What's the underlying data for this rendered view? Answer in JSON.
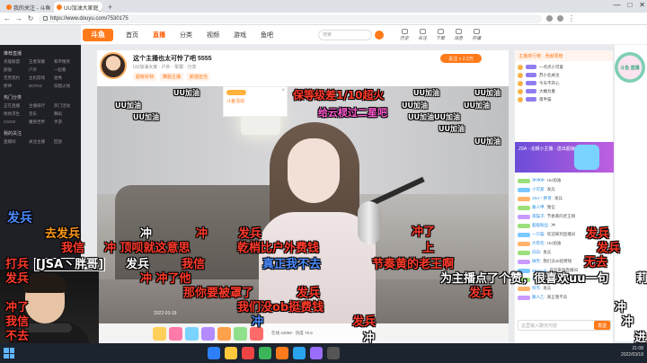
{
  "browser": {
    "tabs": [
      {
        "label": "我的关注 - 斗鱼"
      },
      {
        "label": "UU加油大家庭_户外直播"
      }
    ],
    "new_tab": "+",
    "url": "https://www.douyu.com/7530175",
    "window_controls": [
      "—",
      "□",
      "✕"
    ]
  },
  "site": {
    "logo": "斗鱼",
    "nav": [
      "首页",
      "直播",
      "分类",
      "视频",
      "游戏",
      "鱼吧"
    ],
    "nav_active_index": 1,
    "search_placeholder": "搜索",
    "header_icons": [
      "历史",
      "关注",
      "下载",
      "消息",
      "开播"
    ]
  },
  "sidebar": {
    "section_titles": [
      "推荐直播",
      "热门分类",
      "我的关注"
    ],
    "grid1": [
      "英雄联盟",
      "王者荣耀",
      "和平精英",
      "颜值",
      "户外",
      "一起看",
      "无畏契约",
      "主机游戏",
      "星秀",
      "原神",
      "DOTA2",
      "穿越火线"
    ],
    "grid2": [
      "正在直播",
      "主播排行",
      "热门活动",
      "绝地求生",
      "音乐",
      "舞蹈",
      "CSGO",
      "魔兽世界",
      "手游"
    ],
    "grid3": [
      "直播间",
      "关注主播",
      "回放"
    ]
  },
  "room": {
    "title": "这个主播也太可怜了吧 5555",
    "meta": "UU加油大家 · 户外 · 举报 · 分享",
    "tags": [
      "超级铃铛",
      "舞蹈主播",
      "颜值担当"
    ],
    "follow_label": "关注 + 2.2万"
  },
  "video": {
    "ad_text": "斗鱼活动",
    "ad_close": "×",
    "timer": "2022-03-18",
    "stats": "在线 42859 · 热度 78.8"
  },
  "right_panel": {
    "header": "主播排行榜 · 贡献周榜",
    "ranks": [
      "一点点小可爱",
      "苏小北关注",
      "今天不开心",
      "大橘为重",
      "夜半猫"
    ],
    "gift_popup": "JSA · 北朝小主播 · 送出超级火箭",
    "chat": [
      {
        "name": "冲冲冲:",
        "msg": "UU加油"
      },
      {
        "name": "小可爱:",
        "msg": "发兵"
      },
      {
        "name": "JSA丶胖哥:",
        "msg": "发兵"
      },
      {
        "name": "路人甲:",
        "msg": "我信"
      },
      {
        "name": "夜猫子:",
        "msg": "节奏黄的老王啊"
      },
      {
        "name": "超级粉丝:",
        "msg": "冲"
      },
      {
        "name": "一只猫:",
        "msg": "欢迎来到直播间"
      },
      {
        "name": "大卷毛:",
        "msg": "UU加油"
      },
      {
        "name": "白白:",
        "msg": "发兵"
      },
      {
        "name": "微笑:",
        "msg": "我们没ob挺费钱"
      },
      {
        "name": "Bkenndi:",
        "msg": "欢迎来到直播间"
      },
      {
        "name": "小明:",
        "msg": "冲了他"
      },
      {
        "name": "阿杰:",
        "msg": "发兵"
      },
      {
        "name": "路人乙:",
        "msg": "真正我不去"
      }
    ],
    "input_placeholder": "这里输入聊天内容",
    "send_label": "发送"
  },
  "mascot": "斗鱼\n直播",
  "taskbar": {
    "time": "21:08",
    "date": "2022/03/18"
  },
  "danmaku": [
    {
      "text": "保等级差1/10超火",
      "cls": "dm-red"
    },
    {
      "text": "给云棂过二星吧",
      "cls": "dm-pink"
    },
    {
      "text": "UU加油",
      "cls": "dm-white"
    },
    {
      "text": "UU加油",
      "cls": "dm-white"
    },
    {
      "text": "UU加油",
      "cls": "dm-white"
    },
    {
      "text": "UU加油",
      "cls": "dm-white"
    },
    {
      "text": "UU加油",
      "cls": "dm-white"
    },
    {
      "text": "UU加油",
      "cls": "dm-white"
    },
    {
      "text": "UU加油",
      "cls": "dm-white"
    },
    {
      "text": "UU加油UU加油",
      "cls": "dm-white"
    },
    {
      "text": "UU加油",
      "cls": "dm-white"
    },
    {
      "text": "UU加油",
      "cls": "dm-white"
    },
    {
      "text": "发兵",
      "cls": "dm-blue"
    },
    {
      "text": "冲",
      "cls": "dm-white"
    },
    {
      "text": "冲",
      "cls": "dm-red"
    },
    {
      "text": "发兵",
      "cls": "dm-red"
    },
    {
      "text": "冲了",
      "cls": "dm-red"
    },
    {
      "text": "发兵",
      "cls": "dm-red"
    },
    {
      "text": "去发兵",
      "cls": "dm-orange"
    },
    {
      "text": "我信",
      "cls": "dm-red"
    },
    {
      "text": "冲 顶呗就这意思",
      "cls": "dm-red"
    },
    {
      "text": "乾梢比户外费钱",
      "cls": "dm-red"
    },
    {
      "text": "上",
      "cls": "dm-red"
    },
    {
      "text": "发兵",
      "cls": "dm-red"
    },
    {
      "text": "打兵",
      "cls": "dm-red"
    },
    {
      "text": "[JSA丶胖哥]",
      "cls": "dm-white dm-boxed"
    },
    {
      "text": "发兵",
      "cls": "dm-white"
    },
    {
      "text": "我信",
      "cls": "dm-red"
    },
    {
      "text": "真正我不去",
      "cls": "dm-blue"
    },
    {
      "text": "节奏黄的老王啊",
      "cls": "dm-red"
    },
    {
      "text": "无去",
      "cls": "dm-red"
    },
    {
      "text": "发兵",
      "cls": "dm-red"
    },
    {
      "text": "冲 冲了他",
      "cls": "dm-red"
    },
    {
      "text": "为主播点了个赞，很喜欢uu一句",
      "cls": "dm-white"
    },
    {
      "text": "莉",
      "cls": "dm-white"
    },
    {
      "text": "那你要被罩了",
      "cls": "dm-red"
    },
    {
      "text": "发兵",
      "cls": "dm-red"
    },
    {
      "text": "冲了",
      "cls": "dm-red"
    },
    {
      "text": "发兵",
      "cls": "dm-red"
    },
    {
      "text": "我信",
      "cls": "dm-red"
    },
    {
      "text": "我们没ob挺费钱",
      "cls": "dm-red"
    },
    {
      "text": "不去",
      "cls": "dm-red"
    },
    {
      "text": "冲",
      "cls": "dm-blue"
    },
    {
      "text": "发兵",
      "cls": "dm-red"
    },
    {
      "text": "冲",
      "cls": "dm-white"
    },
    {
      "text": "冲",
      "cls": "dm-white"
    },
    {
      "text": "不去",
      "cls": "dm-white"
    },
    {
      "text": "冲",
      "cls": "dm-white"
    },
    {
      "text": "进",
      "cls": "dm-white"
    }
  ],
  "colors": {
    "brand": "#ff7a1a",
    "sidebar_bg": "#1f1f26",
    "taskbar_bg": "#1c2430"
  }
}
